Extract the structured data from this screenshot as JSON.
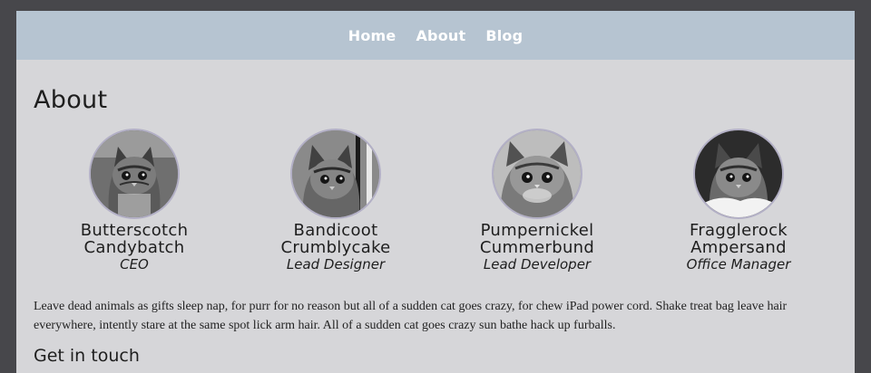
{
  "nav": {
    "items": [
      "Home",
      "About",
      "Blog"
    ]
  },
  "page": {
    "title": "About"
  },
  "team": [
    {
      "name_line1": "Butterscotch",
      "name_line2": "Candybatch",
      "role": "CEO"
    },
    {
      "name_line1": "Bandicoot",
      "name_line2": "Crumblycake",
      "role": "Lead Designer"
    },
    {
      "name_line1": "Pumpernickel",
      "name_line2": "Cummerbund",
      "role": "Lead Developer"
    },
    {
      "name_line1": "Fragglerock",
      "name_line2": "Ampersand",
      "role": "Office Manager"
    }
  ],
  "intro": {
    "text": "Leave dead animals as gifts sleep nap, for purr for no reason but all of a sudden cat goes crazy, for chew iPad power cord. Shake treat bag leave hair everywhere, intently stare at the same spot lick arm hair. All of a sudden cat goes crazy sun bathe hack up furballs."
  },
  "contact": {
    "title": "Get in touch"
  },
  "colors": {
    "background": "#47474b",
    "content": "#d6d6d9",
    "nav_bar": "#b6c4d1",
    "nav_text": "#ffffff",
    "avatar_border": "#b3b0c6"
  },
  "images": [
    "kitten-photo-1",
    "kitten-photo-2",
    "kitten-photo-3",
    "kitten-photo-4"
  ]
}
